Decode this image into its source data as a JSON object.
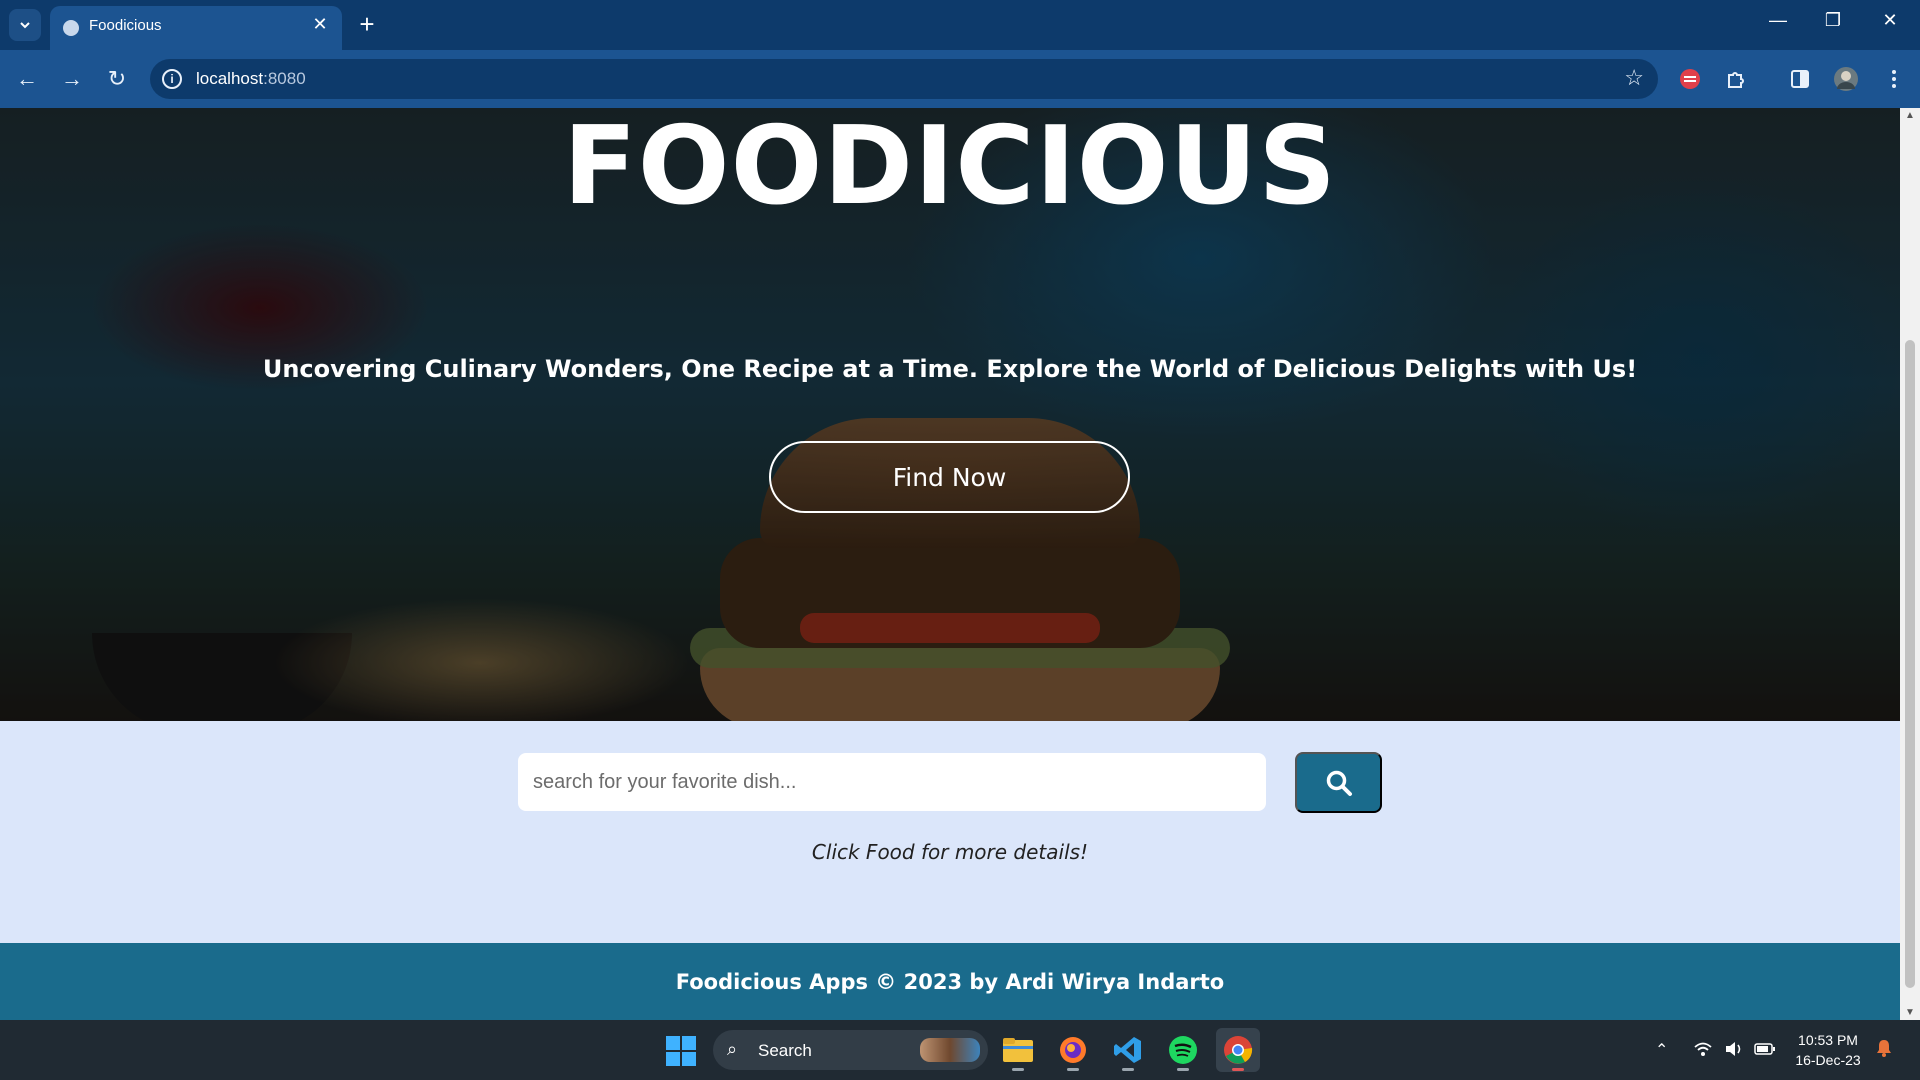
{
  "browser": {
    "tab_title": "Foodicious",
    "url_host": "localhost",
    "url_port": ":8080"
  },
  "hero": {
    "brand": "FOODICIOUS",
    "tagline": "Uncovering Culinary Wonders, One Recipe at a Time. Explore the World of Delicious Delights with Us!",
    "cta_label": "Find Now"
  },
  "search": {
    "placeholder": "search for your favorite dish...",
    "value": "",
    "hint": "Click Food for more details!"
  },
  "footer": {
    "text": "Foodicious Apps © 2023 by Ardi Wirya Indarto"
  },
  "taskbar": {
    "search_label": "Search",
    "time": "10:53 PM",
    "date": "16-Dec-23"
  },
  "colors": {
    "accent": "#1a6b8c",
    "section_bg": "#dbe6fa",
    "chrome": "#1c5491"
  }
}
